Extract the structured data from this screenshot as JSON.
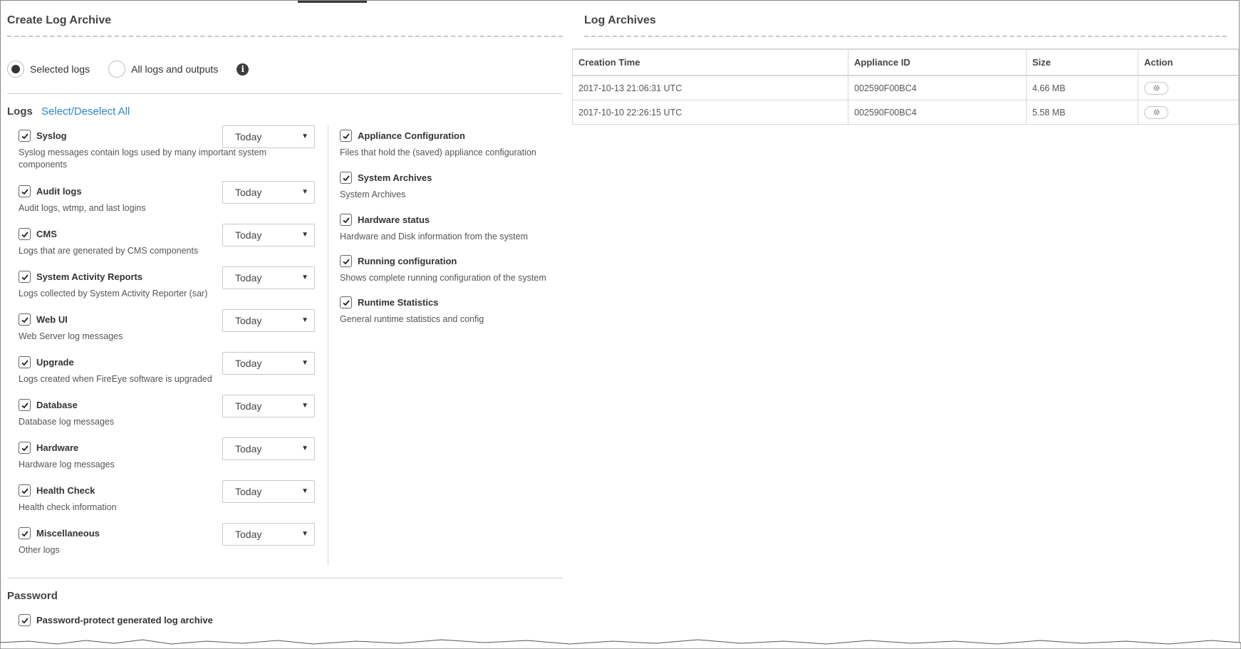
{
  "create": {
    "title": "Create Log Archive",
    "radio_selected": "Selected logs",
    "radio_all": "All logs and outputs",
    "logs_label": "Logs",
    "select_all_link": "Select/Deselect All",
    "left_logs": [
      {
        "name": "Syslog",
        "desc": "Syslog messages contain logs used by many important system components",
        "period": "Today"
      },
      {
        "name": "Audit logs",
        "desc": "Audit logs, wtmp, and last logins",
        "period": "Today"
      },
      {
        "name": "CMS",
        "desc": "Logs that are generated by CMS components",
        "period": "Today"
      },
      {
        "name": "System Activity Reports",
        "desc": "Logs collected by System Activity Reporter (sar)",
        "period": "Today"
      },
      {
        "name": "Web UI",
        "desc": "Web Server log messages",
        "period": "Today"
      },
      {
        "name": "Upgrade",
        "desc": "Logs created when FireEye software is upgraded",
        "period": "Today"
      },
      {
        "name": "Database",
        "desc": "Database log messages",
        "period": "Today"
      },
      {
        "name": "Hardware",
        "desc": "Hardware log messages",
        "period": "Today"
      },
      {
        "name": "Health Check",
        "desc": "Health check information",
        "period": "Today"
      },
      {
        "name": "Miscellaneous",
        "desc": "Other logs",
        "period": "Today"
      }
    ],
    "right_logs": [
      {
        "name": "Appliance Configuration",
        "desc": "Files that hold the (saved) appliance configuration"
      },
      {
        "name": "System Archives",
        "desc": "System Archives"
      },
      {
        "name": "Hardware status",
        "desc": "Hardware and Disk information from the system"
      },
      {
        "name": "Running configuration",
        "desc": "Shows complete running configuration of the system"
      },
      {
        "name": "Runtime Statistics",
        "desc": "General runtime statistics and config"
      }
    ],
    "password_title": "Password",
    "password_protect": "Password-protect generated log archive"
  },
  "archives": {
    "title": "Log Archives",
    "columns": [
      "Creation Time",
      "Appliance ID",
      "Size",
      "Action"
    ],
    "rows": [
      {
        "time": "2017-10-13 21:06:31 UTC",
        "appliance": "002590F00BC4",
        "size": "4.66 MB"
      },
      {
        "time": "2017-10-10 22:26:15 UTC",
        "appliance": "002590F00BC4",
        "size": "5.58 MB"
      }
    ]
  }
}
